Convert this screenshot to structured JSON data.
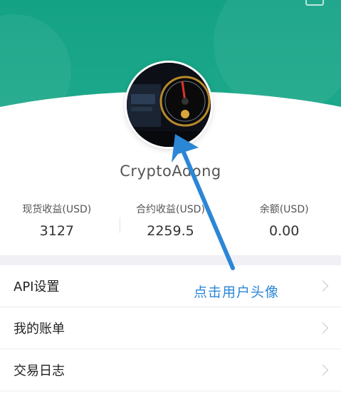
{
  "profile": {
    "username": "CryptoAdong"
  },
  "stats": [
    {
      "label": "现货收益(USD)",
      "value": "3127"
    },
    {
      "label": "合约收益(USD)",
      "value": "2259.5"
    },
    {
      "label": "余额(USD)",
      "value": "0.00"
    }
  ],
  "menu": {
    "items": [
      {
        "label": "API设置"
      },
      {
        "label": "我的账单"
      },
      {
        "label": "交易日志"
      }
    ]
  },
  "annotation": {
    "text": "点击用户头像"
  },
  "colors": {
    "header_green": "#14a285",
    "annotation_blue": "#2b86d6",
    "divider_band": "#f0f0f5"
  },
  "icons": {
    "menu_chevron": "chevron-right-icon",
    "annotation_arrow": "arrow-up-icon"
  }
}
